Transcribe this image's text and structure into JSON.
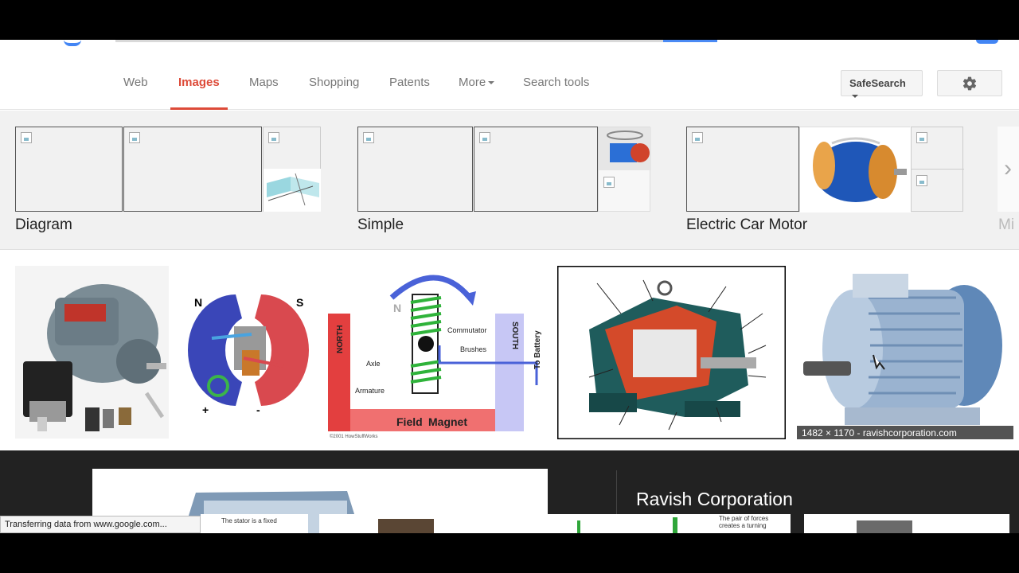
{
  "nav": {
    "items": [
      {
        "label": "Web",
        "active": false
      },
      {
        "label": "Images",
        "active": true
      },
      {
        "label": "Maps",
        "active": false
      },
      {
        "label": "Shopping",
        "active": false
      },
      {
        "label": "Patents",
        "active": false
      },
      {
        "label": "More",
        "active": false
      },
      {
        "label": "Search tools",
        "active": false
      }
    ],
    "safesearch_label": "SafeSearch",
    "settings_icon": "gear-icon"
  },
  "related": {
    "groups": [
      {
        "label": "Diagram"
      },
      {
        "label": "Simple"
      },
      {
        "label": "Electric Car Motor"
      }
    ],
    "overflow_label": "Mi"
  },
  "results": {
    "items": [
      {
        "description": "industrial-motors-collage"
      },
      {
        "description": "magnet-motor-diagram",
        "pole_left": "N",
        "pole_right": "S"
      },
      {
        "description": "dc-motor-diagram",
        "labels": {
          "north": "NORTH",
          "south": "SOUTH",
          "commutator": "Commutator",
          "brushes": "Brushes",
          "axle": "Axle",
          "armature": "Armature",
          "field": "Field",
          "magnet": "Magnet",
          "battery": "To Battery",
          "arrow": "N",
          "credit": "©2001 HowStuffWorks"
        }
      },
      {
        "description": "motor-cutaway-diagram"
      },
      {
        "description": "ravish-motor",
        "info": "1482 × 1170 - ravishcorporation.com"
      }
    ]
  },
  "preview": {
    "title": "Ravish Corporation",
    "caption_fragment": "The stator is a fixed",
    "forces_fragment_line1": "The pair of forces",
    "forces_fragment_line2": "creates a turning"
  },
  "status": {
    "text": "Transferring data from www.google.com..."
  },
  "colors": {
    "active_tab": "#dd4b39",
    "nav_text": "#777777",
    "accent_blue": "#4285f4"
  }
}
